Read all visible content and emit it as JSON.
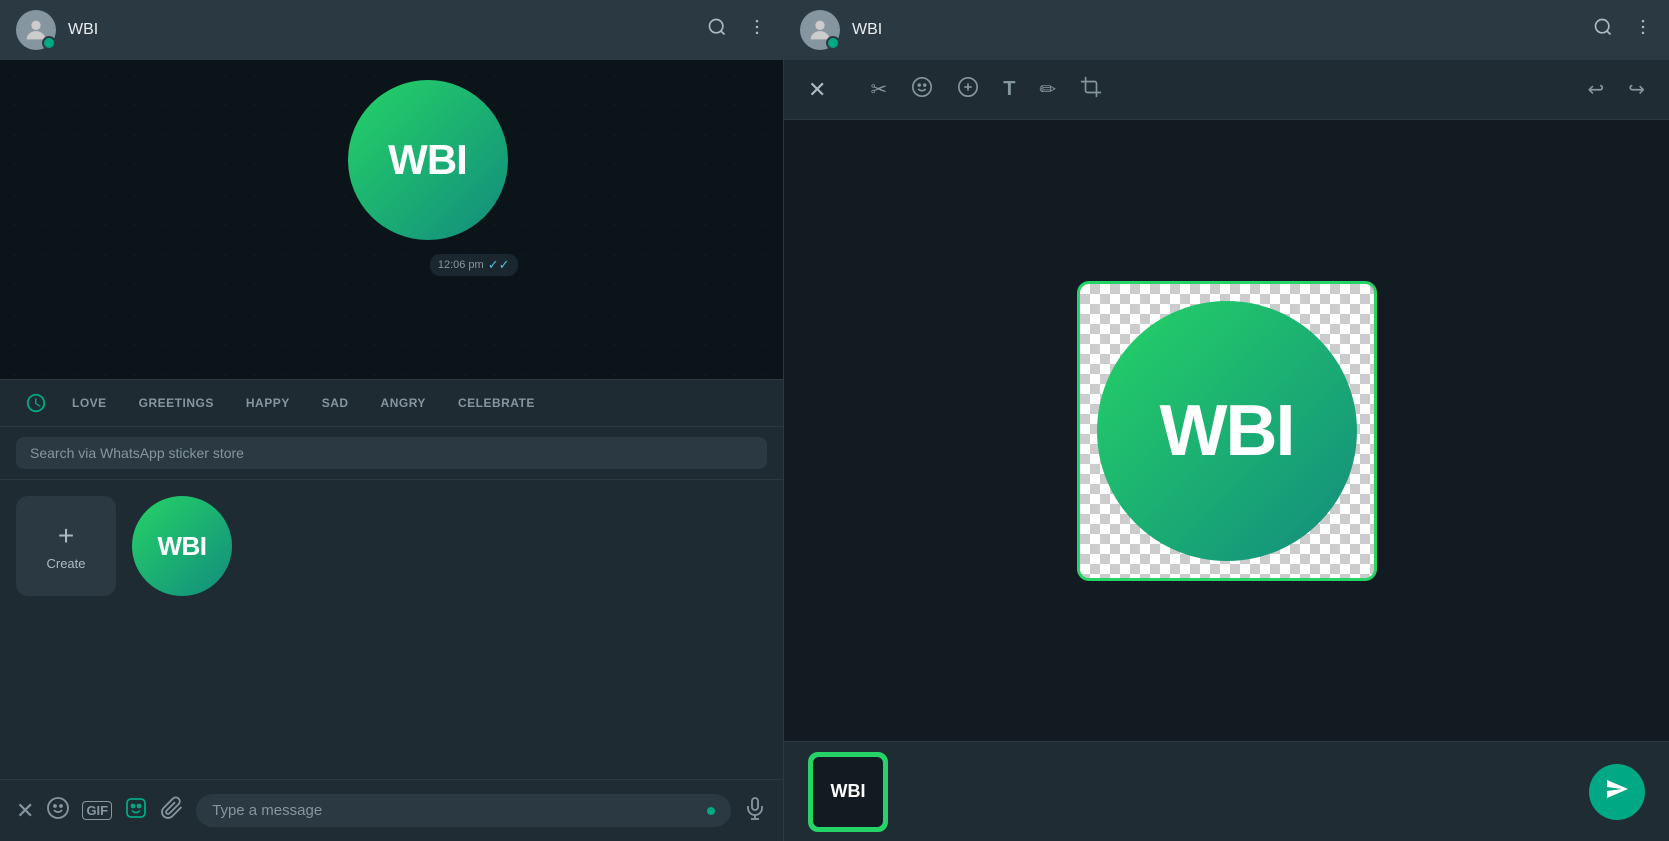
{
  "left": {
    "header": {
      "title": "WBI",
      "search_label": "Search",
      "menu_label": "Menu"
    },
    "message": {
      "time": "12:06 pm",
      "check": "✓✓"
    },
    "sticker_tabs": [
      {
        "id": "recent",
        "label": "",
        "icon": "clock",
        "active": true
      },
      {
        "id": "love",
        "label": "LOVE",
        "active": false
      },
      {
        "id": "greetings",
        "label": "GREETINGS",
        "active": false
      },
      {
        "id": "happy",
        "label": "HAPPY",
        "active": false
      },
      {
        "id": "sad",
        "label": "SAD",
        "active": false
      },
      {
        "id": "angry",
        "label": "ANGRY",
        "active": false
      },
      {
        "id": "celebrate",
        "label": "CELEBRATE",
        "active": false
      }
    ],
    "search_placeholder": "Search via WhatsApp sticker store",
    "create_label": "Create",
    "sticker_wbi_text": "WBI",
    "toolbar": {
      "close_label": "✕",
      "emoji_label": "🙂",
      "stickers_label": "⊕",
      "attach_label": "📎",
      "input_placeholder": "Type a message",
      "mic_label": "🎤"
    }
  },
  "right": {
    "header": {
      "title": "WBI",
      "search_label": "Search",
      "menu_label": "Menu"
    },
    "editor": {
      "close_label": "✕",
      "scissors_label": "✂",
      "emoji_label": "😊",
      "sticker_label": "⊕",
      "text_label": "T",
      "draw_label": "✏",
      "crop_label": "⊡",
      "undo_label": "↩",
      "redo_label": "↪"
    },
    "wbi_text": "WBI",
    "preview_wbi_text": "WBI",
    "send_icon": "➤"
  }
}
